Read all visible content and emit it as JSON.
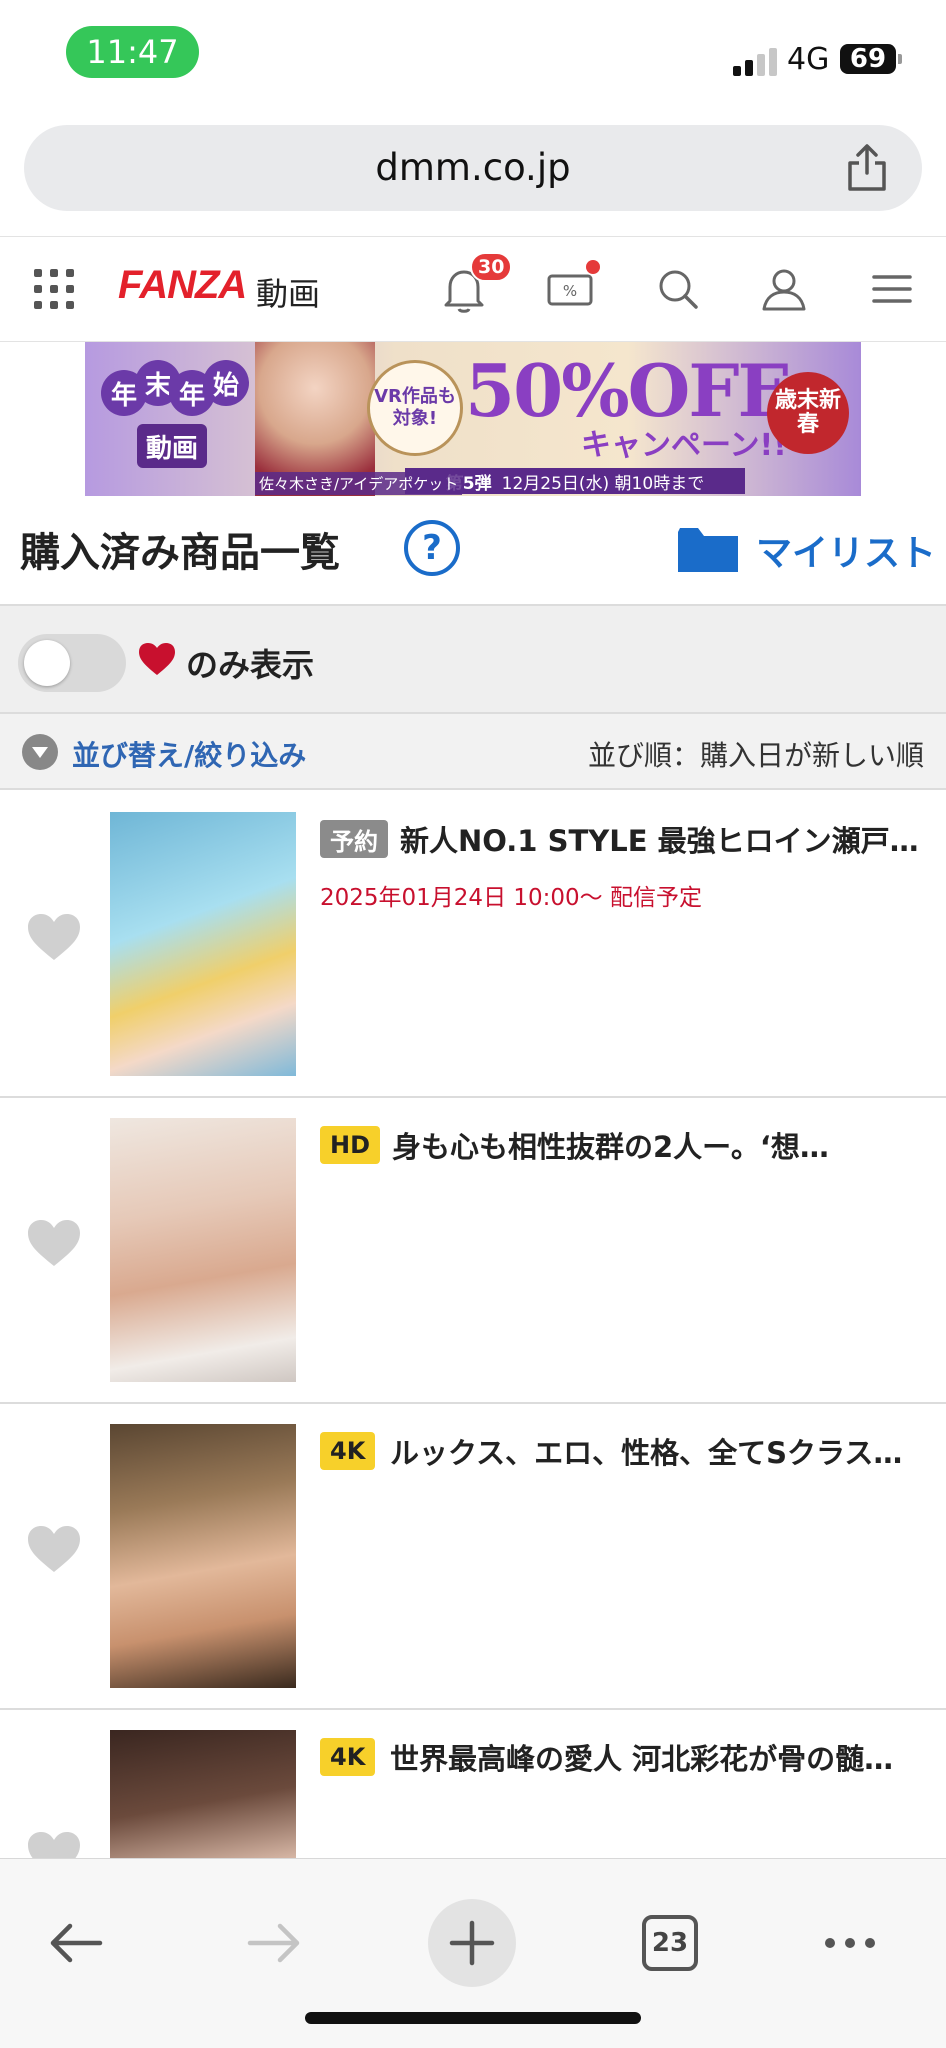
{
  "status_bar": {
    "time": "11:47",
    "network": "4G",
    "battery": "69"
  },
  "browser": {
    "url": "dmm.co.jp",
    "tab_count": "23"
  },
  "header": {
    "logo": "FANZA",
    "logo_sub": "動画",
    "notification_count": "30",
    "icons": [
      "grid-menu-icon",
      "bell-icon",
      "coupon-icon",
      "search-icon",
      "user-icon",
      "hamburger-icon"
    ],
    "brand_color": "#e3212b",
    "accent_color": "#1a6cc9"
  },
  "banner": {
    "left_kanji": [
      "年",
      "末",
      "年",
      "始"
    ],
    "left_label": "動画",
    "vr_note": "VR作品も対象!",
    "offer_main": "50%OFF",
    "offer_sub": "キャンペーン!!",
    "phase": "第5弾",
    "deadline": "12月25日(水) 朝10時まで",
    "credit": "佐々木さき/アイデアポケット",
    "seal": "歳末新春"
  },
  "page": {
    "title": "購入済み商品一覧",
    "help": "?",
    "mylist_label": "マイリスト"
  },
  "filter": {
    "favorites_only_label": "のみ表示",
    "favorites_only": false
  },
  "sort": {
    "link_label": "並び替え/絞り込み",
    "order_label": "並び順：購入日が新しい順"
  },
  "products": [
    {
      "badge": "予約",
      "title": "新人NO.1 STYLE 最強ヒロイン瀬戸…",
      "date": "2025年01月24日 10:00〜 配信予定",
      "favorite": false
    },
    {
      "badge": "HD",
      "title": "身も心も相性抜群の2人ー。‘想…",
      "date": "",
      "favorite": false
    },
    {
      "badge": "4K",
      "title": "ルックス、エロ、性格、全てSクラス…",
      "date": "",
      "favorite": false
    },
    {
      "badge": "4K",
      "title": "世界最高峰の愛人 河北彩花が骨の髄ま…",
      "date": "",
      "favorite": false
    }
  ]
}
